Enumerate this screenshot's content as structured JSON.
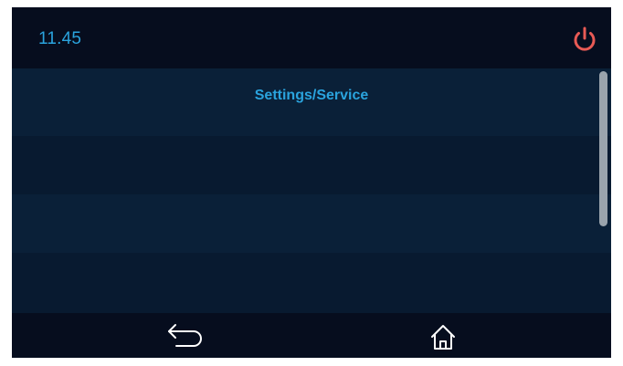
{
  "status": {
    "time": "11.45"
  },
  "menu": {
    "title": "Settings/Service"
  },
  "icons": {
    "power": "power-icon",
    "back": "back-arrow-icon",
    "home": "home-icon"
  },
  "colors": {
    "accent": "#2aa3dd",
    "power": "#e85a55",
    "background": "#0a1326",
    "bar_background": "#060d1e",
    "row_light": "#0a2038",
    "row_dark": "#081a30",
    "scrollbar": "#9aa4ad"
  }
}
